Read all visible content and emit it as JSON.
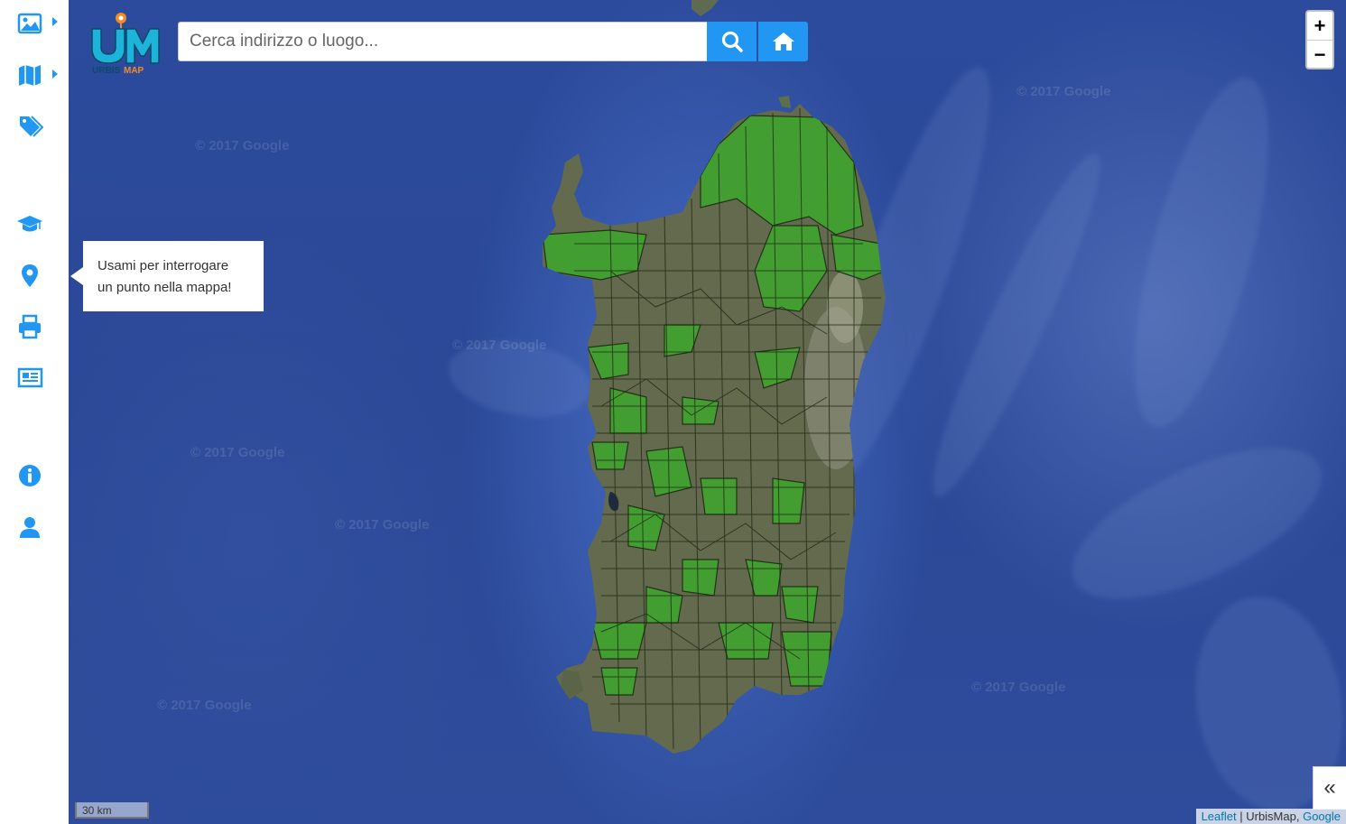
{
  "logo": {
    "text_top": "UM",
    "text_bottom": "URBISMAP"
  },
  "search": {
    "placeholder": "Cerca indirizzo o luogo...",
    "value": ""
  },
  "buttons": {
    "search_icon": "search-icon",
    "home_icon": "home-icon"
  },
  "zoom": {
    "in": "+",
    "out": "−"
  },
  "sidebar": {
    "items": [
      {
        "name": "image-icon"
      },
      {
        "name": "map-icon"
      },
      {
        "name": "tags-icon"
      },
      {
        "name": "graduation-cap-icon"
      },
      {
        "name": "map-marker-icon"
      },
      {
        "name": "print-icon"
      },
      {
        "name": "newspaper-icon"
      },
      {
        "name": "info-icon"
      },
      {
        "name": "user-icon"
      }
    ]
  },
  "tooltip": {
    "line1": "Usami per interrogare",
    "line2": "un punto nella mappa!"
  },
  "scale": {
    "label": "30 km"
  },
  "attribution": {
    "leaflet": "Leaflet",
    "sep1": " | UrbisMap, ",
    "google": "Google"
  },
  "collapse": {
    "label": "«"
  },
  "watermarks": [
    "© 2017 Google",
    "© 2017 Google",
    "© 2017 Google",
    "© 2017 Google",
    "© 2017 Google",
    "© 2017 Google",
    "© 2017 Google"
  ],
  "colors": {
    "accent": "#2196f3",
    "sea": "#2d4b9c",
    "municipality_green": "#3fa52e"
  }
}
